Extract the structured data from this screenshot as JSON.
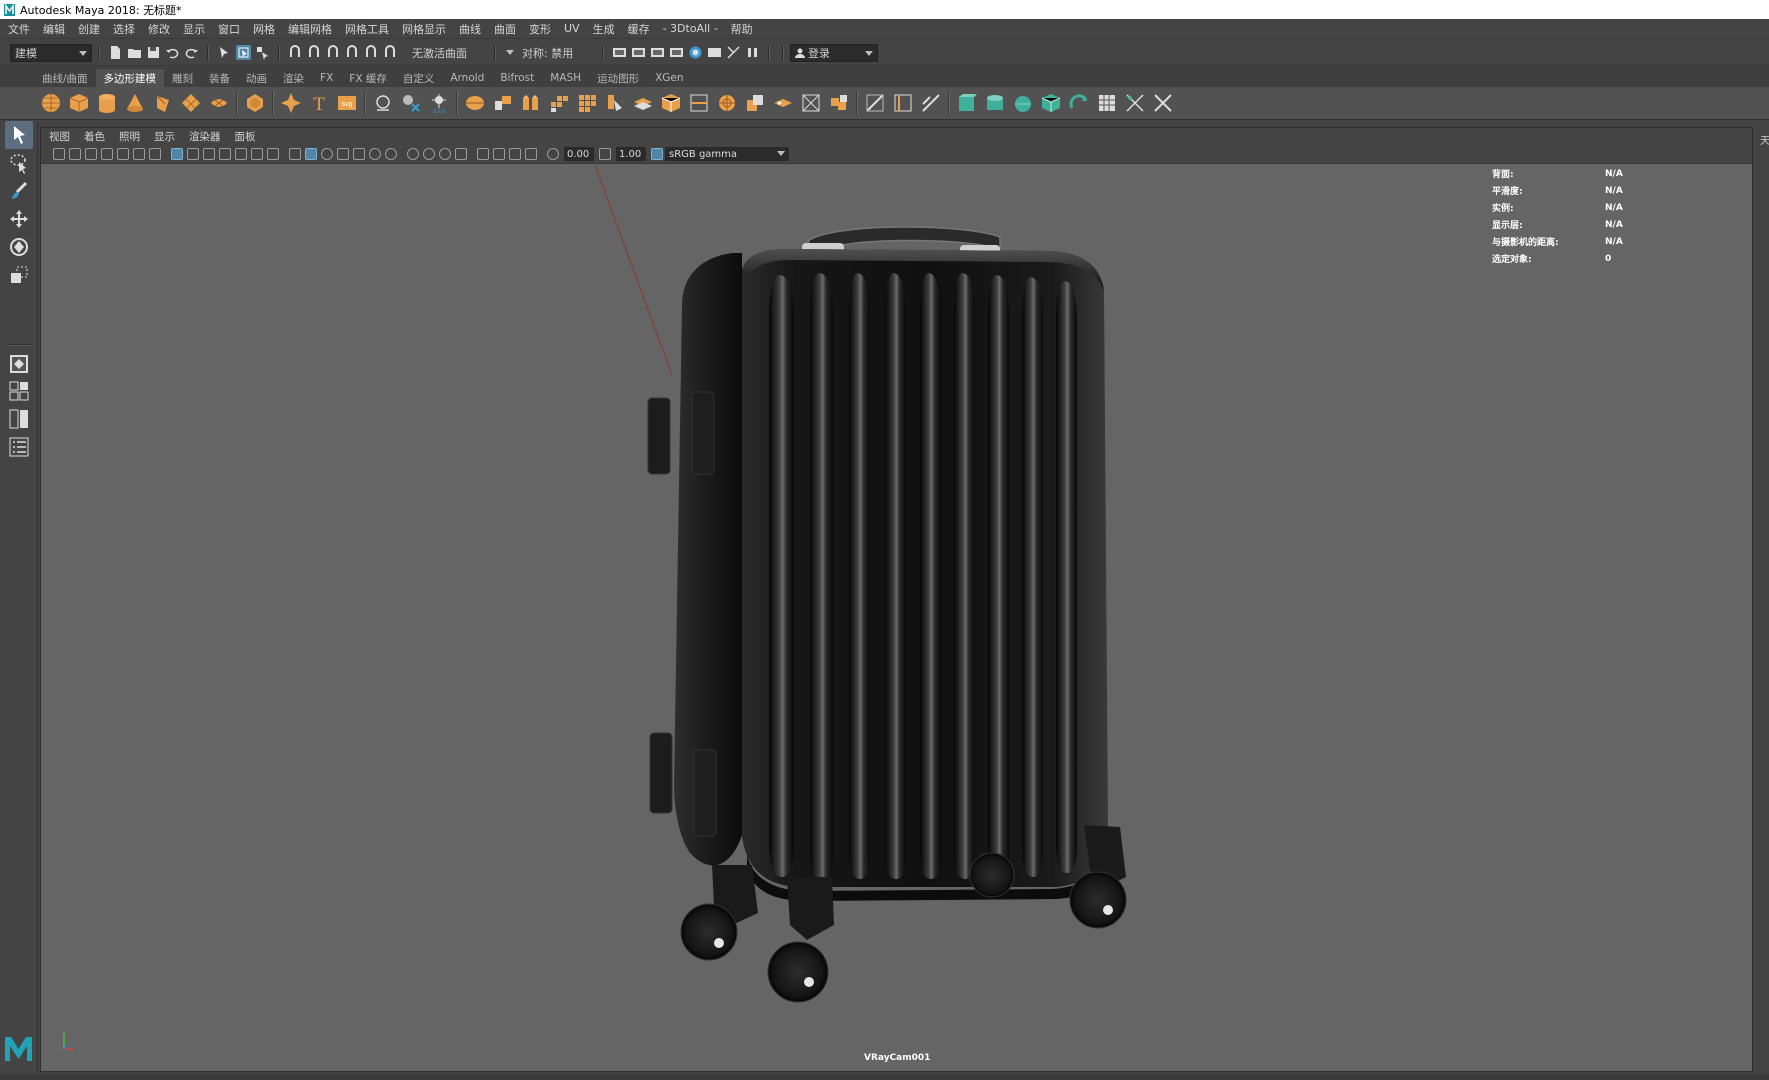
{
  "window": {
    "title": "Autodesk Maya 2018: 无标题*"
  },
  "menubar": {
    "items": [
      "文件",
      "编辑",
      "创建",
      "选择",
      "修改",
      "显示",
      "窗口",
      "网格",
      "编辑网格",
      "网格工具",
      "网格显示",
      "曲线",
      "曲面",
      "变形",
      "UV",
      "生成",
      "缓存",
      "- 3DtoAll -",
      "帮助"
    ]
  },
  "statusline": {
    "menu_set": "建模",
    "live_surface": "无激活曲面",
    "symmetry": "对称: 禁用",
    "login": "登录"
  },
  "shelf": {
    "tabs": [
      "曲线/曲面",
      "多边形建模",
      "雕刻",
      "装备",
      "动画",
      "渲染",
      "FX",
      "FX 缓存",
      "自定义",
      "Arnold",
      "Bifrost",
      "MASH",
      "运动图形",
      "XGen"
    ],
    "active_tab": "多边形建模",
    "text_icon": "T",
    "svg_icon": "svg",
    "coord_icon": "0,0,0"
  },
  "panel": {
    "menu": [
      "视图",
      "着色",
      "照明",
      "显示",
      "渲染器",
      "面板"
    ],
    "exposure": "0.00",
    "gamma": "1.00",
    "color_space": "sRGB gamma"
  },
  "hud": {
    "rows": [
      {
        "key": "背面:",
        "value": "N/A"
      },
      {
        "key": "平滑度:",
        "value": "N/A"
      },
      {
        "key": "实例:",
        "value": "N/A"
      },
      {
        "key": "显示层:",
        "value": "N/A"
      },
      {
        "key": "与摄影机的距离:",
        "value": "N/A"
      },
      {
        "key": "选定对象:",
        "value": "0"
      }
    ]
  },
  "viewport": {
    "camera": "VRayCam001"
  },
  "right_edge_label": "天",
  "colors": {
    "shelf_icon_orange": "#e8a04a",
    "shelf_icon_green": "#3fb09a",
    "active_blue": "#5285a6",
    "viewport_bg": "#656565",
    "ui_bg": "#444444"
  }
}
